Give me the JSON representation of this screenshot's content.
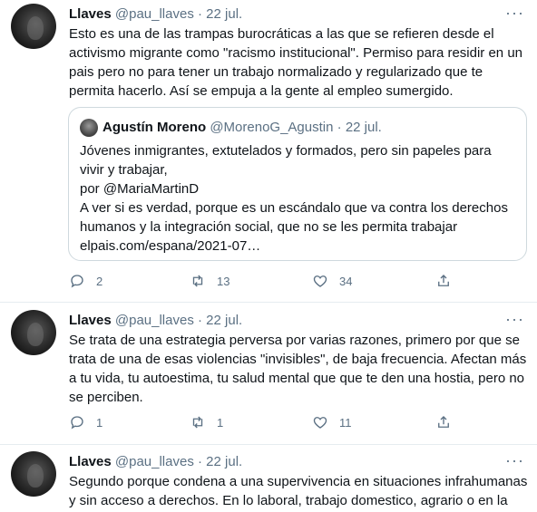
{
  "tweets": [
    {
      "name": "Llaves",
      "handle": "@pau_llaves",
      "sep": "·",
      "date": "22 jul.",
      "more": "···",
      "text": "Esto es una de las trampas burocráticas a las que se refieren desde el activismo migrante como \"racismo institucional\".  Permiso para residir en un pais pero no para tener un trabajo normalizado y regularizado que te permita hacerlo. Así se empuja a la gente al empleo sumergido.",
      "quote": {
        "name": "Agustín Moreno",
        "handle": "@MorenoG_Agustin",
        "sep": "·",
        "date": "22 jul.",
        "lines": [
          "Jóvenes inmigrantes, extutelados y formados, pero sin papeles para vivir y trabajar,",
          "por @MariaMartinD",
          "A ver si es verdad, porque es un escándalo que va contra los derechos humanos y la integración social, que no se les permita trabajar",
          "elpais.com/espana/2021-07…"
        ]
      },
      "replies": "2",
      "retweets": "13",
      "likes": "34"
    },
    {
      "name": "Llaves",
      "handle": "@pau_llaves",
      "sep": "·",
      "date": "22 jul.",
      "more": "···",
      "text": "Se trata de una estrategia perversa por varias razones, primero por que se trata de una de esas violencias \"invisibles\", de baja frecuencia. Afectan más a tu vida, tu autoestima, tu salud mental que que te den una hostia, pero no se perciben.",
      "replies": "1",
      "retweets": "1",
      "likes": "11"
    },
    {
      "name": "Llaves",
      "handle": "@pau_llaves",
      "sep": "·",
      "date": "22 jul.",
      "more": "···",
      "text": "Segundo porque condena a una supervivencia en situaciones infrahumanas y sin acceso a derechos. En lo laboral, trabajo domestico, agrario o en la"
    }
  ]
}
